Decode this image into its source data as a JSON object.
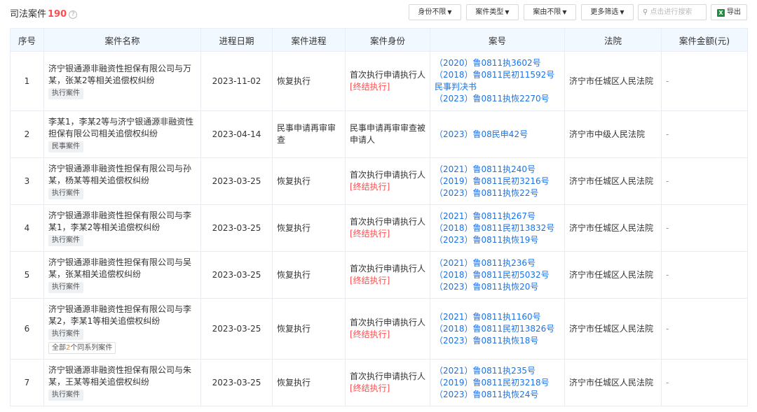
{
  "header": {
    "title": "司法案件",
    "count": "190",
    "help_icon": "?"
  },
  "toolbar": {
    "filters": [
      {
        "label": "身份不限"
      },
      {
        "label": "案件类型"
      },
      {
        "label": "案由不限"
      },
      {
        "label": "更多筛选"
      }
    ],
    "search_placeholder": "点击进行搜索",
    "export_label": "导出",
    "export_icon_text": "X"
  },
  "table": {
    "columns": [
      "序号",
      "案件名称",
      "进程日期",
      "案件进程",
      "案件身份",
      "案号",
      "法院",
      "案件金额(元)"
    ],
    "rows": [
      {
        "no": "1",
        "name": "济宁银通源非融资性担保有限公司与万某，张某2等相关追偿权纠纷",
        "tag": "执行案件",
        "date": "2023-11-02",
        "progress": "恢复执行",
        "identity": "首次执行申请执行人",
        "status": "[终结执行]",
        "case_nos": [
          "（2020）鲁0811执3602号",
          "（2018）鲁0811民初11592号",
          "民事判决书",
          "（2023）鲁0811执恢2270号"
        ],
        "court": "济宁市任城区人民法院",
        "amount": "-"
      },
      {
        "no": "2",
        "name": "李某1，李某2等与济宁银通源非融资性担保有限公司相关追偿权纠纷",
        "tag": "民事案件",
        "date": "2023-04-14",
        "progress": "民事申请再审审查",
        "identity": "民事申请再审审查被申请人",
        "status": "",
        "case_nos": [
          "（2023）鲁08民申42号"
        ],
        "court": "济宁市中级人民法院",
        "amount": "-"
      },
      {
        "no": "3",
        "name": "济宁银通源非融资性担保有限公司与孙某，杨某等相关追偿权纠纷",
        "tag": "执行案件",
        "date": "2023-03-25",
        "progress": "恢复执行",
        "identity": "首次执行申请执行人",
        "status": "[终结执行]",
        "case_nos": [
          "（2021）鲁0811执240号",
          "（2019）鲁0811民初3216号",
          "（2023）鲁0811执恢22号"
        ],
        "court": "济宁市任城区人民法院",
        "amount": "-"
      },
      {
        "no": "4",
        "name": "济宁银通源非融资性担保有限公司与李某1，李某2等相关追偿权纠纷",
        "tag": "执行案件",
        "date": "2023-03-25",
        "progress": "恢复执行",
        "identity": "首次执行申请执行人",
        "status": "[终结执行]",
        "case_nos": [
          "（2021）鲁0811执267号",
          "（2018）鲁0811民初13832号",
          "（2023）鲁0811执恢19号"
        ],
        "court": "济宁市任城区人民法院",
        "amount": "-"
      },
      {
        "no": "5",
        "name": "济宁银通源非融资性担保有限公司与吴某，张某相关追偿权纠纷",
        "tag": "执行案件",
        "date": "2023-03-25",
        "progress": "恢复执行",
        "identity": "首次执行申请执行人",
        "status": "[终结执行]",
        "case_nos": [
          "（2021）鲁0811执236号",
          "（2018）鲁0811民初5032号",
          "（2023）鲁0811执恢20号"
        ],
        "court": "济宁市任城区人民法院",
        "amount": "-"
      },
      {
        "no": "6",
        "name": "济宁银通源非融资性担保有限公司与李某2，李某1等相关追偿权纠纷",
        "tag": "执行案件",
        "series": {
          "prefix": "全部",
          "n": "2",
          "suffix": "个同系列案件"
        },
        "date": "2023-03-25",
        "progress": "恢复执行",
        "identity": "首次执行申请执行人",
        "status": "[终结执行]",
        "case_nos": [
          "（2021）鲁0811执1160号",
          "（2018）鲁0811民初13826号",
          "（2023）鲁0811执恢18号"
        ],
        "court": "济宁市任城区人民法院",
        "amount": "-"
      },
      {
        "no": "7",
        "name": "济宁银通源非融资性担保有限公司与朱某，王某等相关追偿权纠纷",
        "tag": "执行案件",
        "date": "2023-03-25",
        "progress": "恢复执行",
        "identity": "首次执行申请执行人",
        "status": "[终结执行]",
        "case_nos": [
          "（2021）鲁0811执235号",
          "（2019）鲁0811民初3218号",
          "（2023）鲁0811执恢24号"
        ],
        "court": "济宁市任城区人民法院",
        "amount": "-"
      }
    ]
  }
}
